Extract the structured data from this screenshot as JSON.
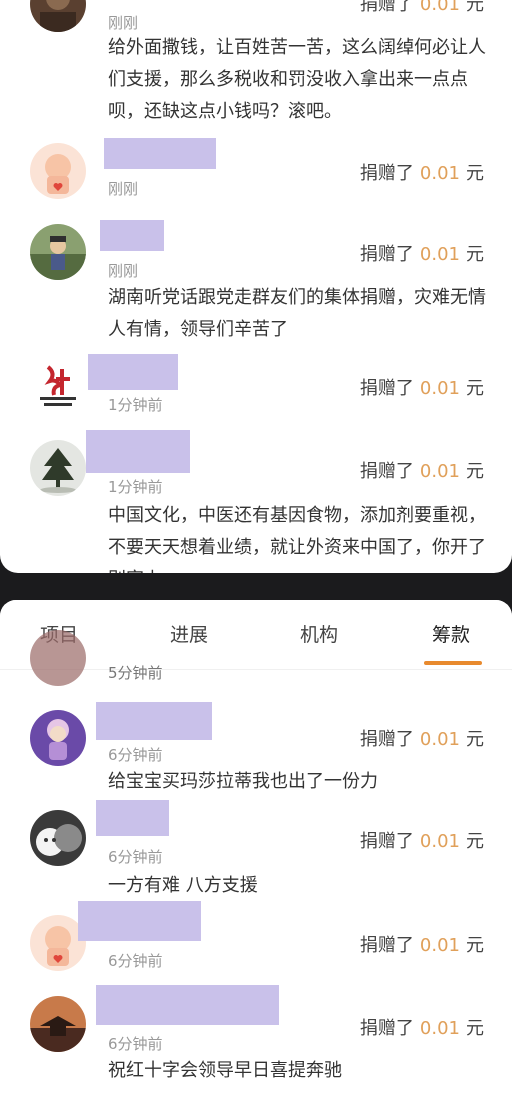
{
  "top_feed": [
    {
      "time": "刚刚",
      "donation": {
        "prefix": "捐赠了",
        "amount": "0.01",
        "unit": "元"
      },
      "comment": "给外面撒钱，让百姓苦一苦，这么阔绰何必让人们支援，那么多税收和罚没收入拿出来一点点呗，还缺这点小钱吗？滚吧。"
    },
    {
      "time": "刚刚",
      "donation": {
        "prefix": "捐赠了",
        "amount": "0.01",
        "unit": "元"
      },
      "comment": ""
    },
    {
      "time": "刚刚",
      "donation": {
        "prefix": "捐赠了",
        "amount": "0.01",
        "unit": "元"
      },
      "comment": "湖南听党话跟党走群友们的集体捐赠，灾难无情人有情，领导们辛苦了"
    },
    {
      "time": "1分钟前",
      "donation": {
        "prefix": "捐赠了",
        "amount": "0.01",
        "unit": "元"
      },
      "comment": ""
    },
    {
      "time": "1分钟前",
      "donation": {
        "prefix": "捐赠了",
        "amount": "0.01",
        "unit": "元"
      },
      "comment": "中国文化，中医还有基因食物，添加剂要重视，不要天天想着业绩，就让外资来中国了，你开了别家上"
    }
  ],
  "tabs": [
    "项目",
    "进展",
    "机构",
    "筹款"
  ],
  "active_tab": "筹款",
  "bottom_partial_time": "5分钟前",
  "bottom_feed": [
    {
      "time": "6分钟前",
      "donation": {
        "prefix": "捐赠了",
        "amount": "0.01",
        "unit": "元"
      },
      "comment": "给宝宝买玛莎拉蒂我也出了一份力"
    },
    {
      "time": "6分钟前",
      "donation": {
        "prefix": "捐赠了",
        "amount": "0.01",
        "unit": "元"
      },
      "comment": "一方有难 八方支援"
    },
    {
      "time": "6分钟前",
      "donation": {
        "prefix": "捐赠了",
        "amount": "0.01",
        "unit": "元"
      },
      "comment": ""
    },
    {
      "time": "6分钟前",
      "donation": {
        "prefix": "捐赠了",
        "amount": "0.01",
        "unit": "元"
      },
      "comment": "祝红十字会领导早日喜提奔驰"
    }
  ],
  "colors": {
    "amount": "#e0a05a",
    "tab_indicator": "#e88a2e",
    "redacted_name": "#c9c1ea"
  }
}
